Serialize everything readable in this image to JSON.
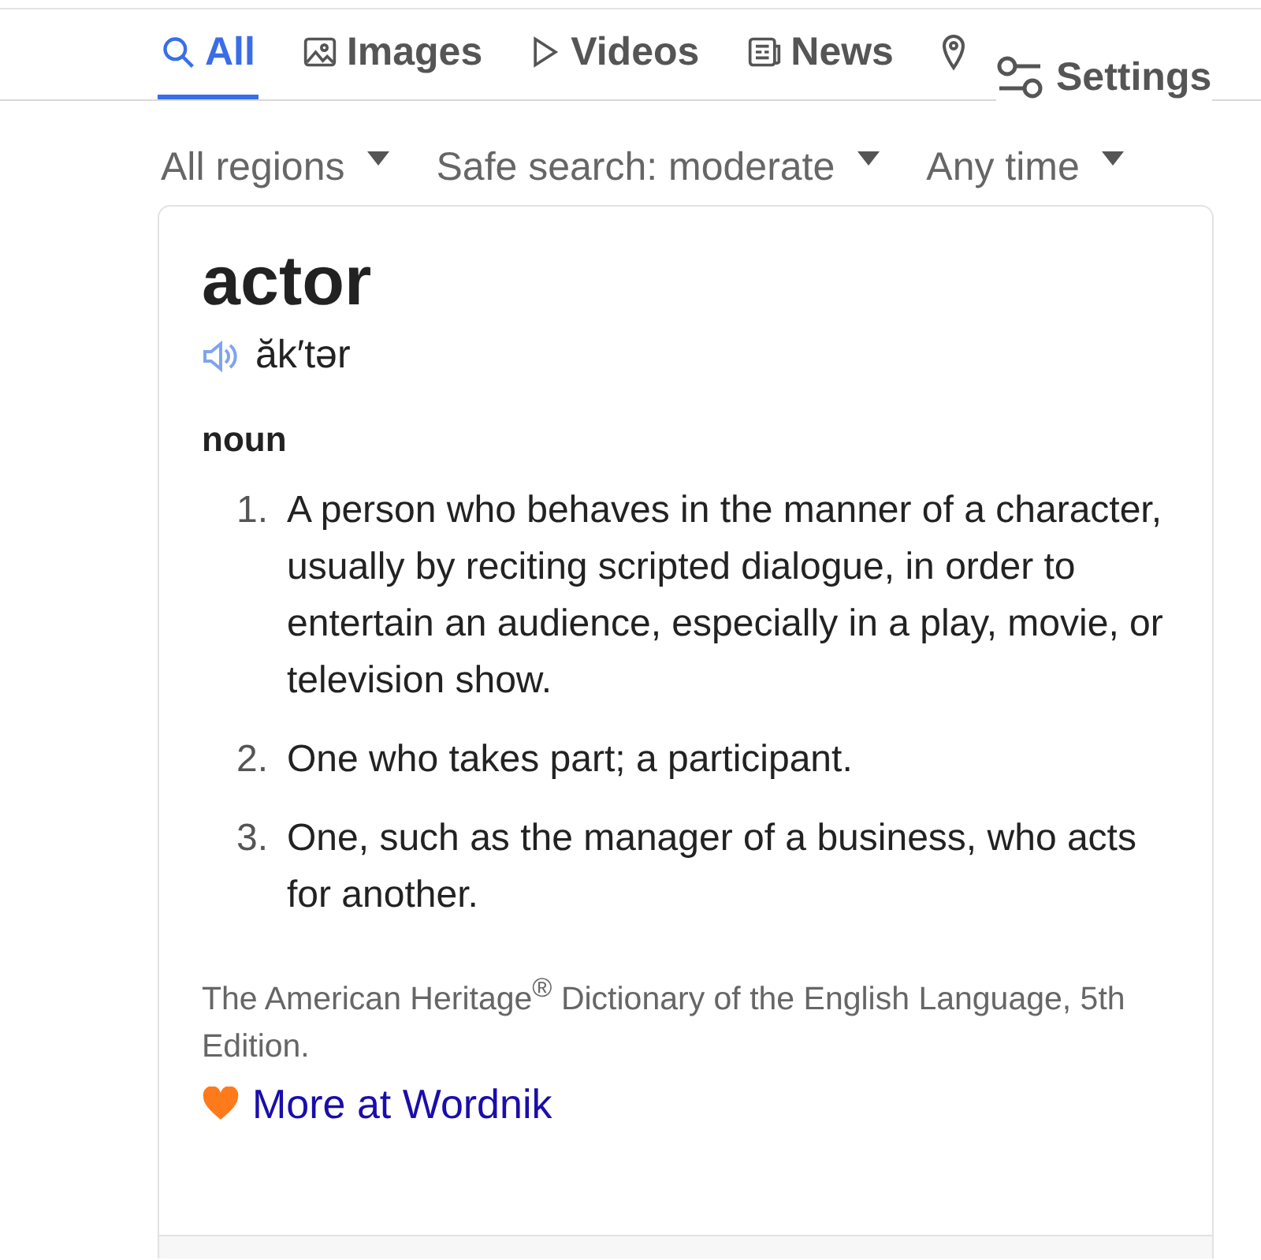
{
  "tabs": [
    {
      "kind": "search",
      "label": "All",
      "selected": true
    },
    {
      "kind": "image",
      "label": "Images",
      "selected": false
    },
    {
      "kind": "video",
      "label": "Videos",
      "selected": false
    },
    {
      "kind": "news",
      "label": "News",
      "selected": false
    },
    {
      "kind": "pin",
      "selected": false
    }
  ],
  "settings": {
    "label": "Settings"
  },
  "filters": [
    {
      "label": "All regions"
    },
    {
      "label": "Safe search: moderate"
    },
    {
      "label": "Any time"
    }
  ],
  "entry": {
    "word": "actor",
    "pronunciation": "ăk′tər",
    "part_of_speech": "noun",
    "definitions": [
      {
        "number": "1.",
        "text": "A person who behaves in the manner of a character, usually by reciting scripted dialogue, in order to entertain an audience, especially in a play, movie, or television show."
      },
      {
        "number": "2.",
        "text": "One who takes part; a participant."
      },
      {
        "number": "3.",
        "text": "One, such as the manager of a business, who acts for another."
      }
    ],
    "source": "The American Heritage$^{®}$ Dictionary of the English Language, 5th Edition.",
    "link": "More at Wordnik"
  }
}
